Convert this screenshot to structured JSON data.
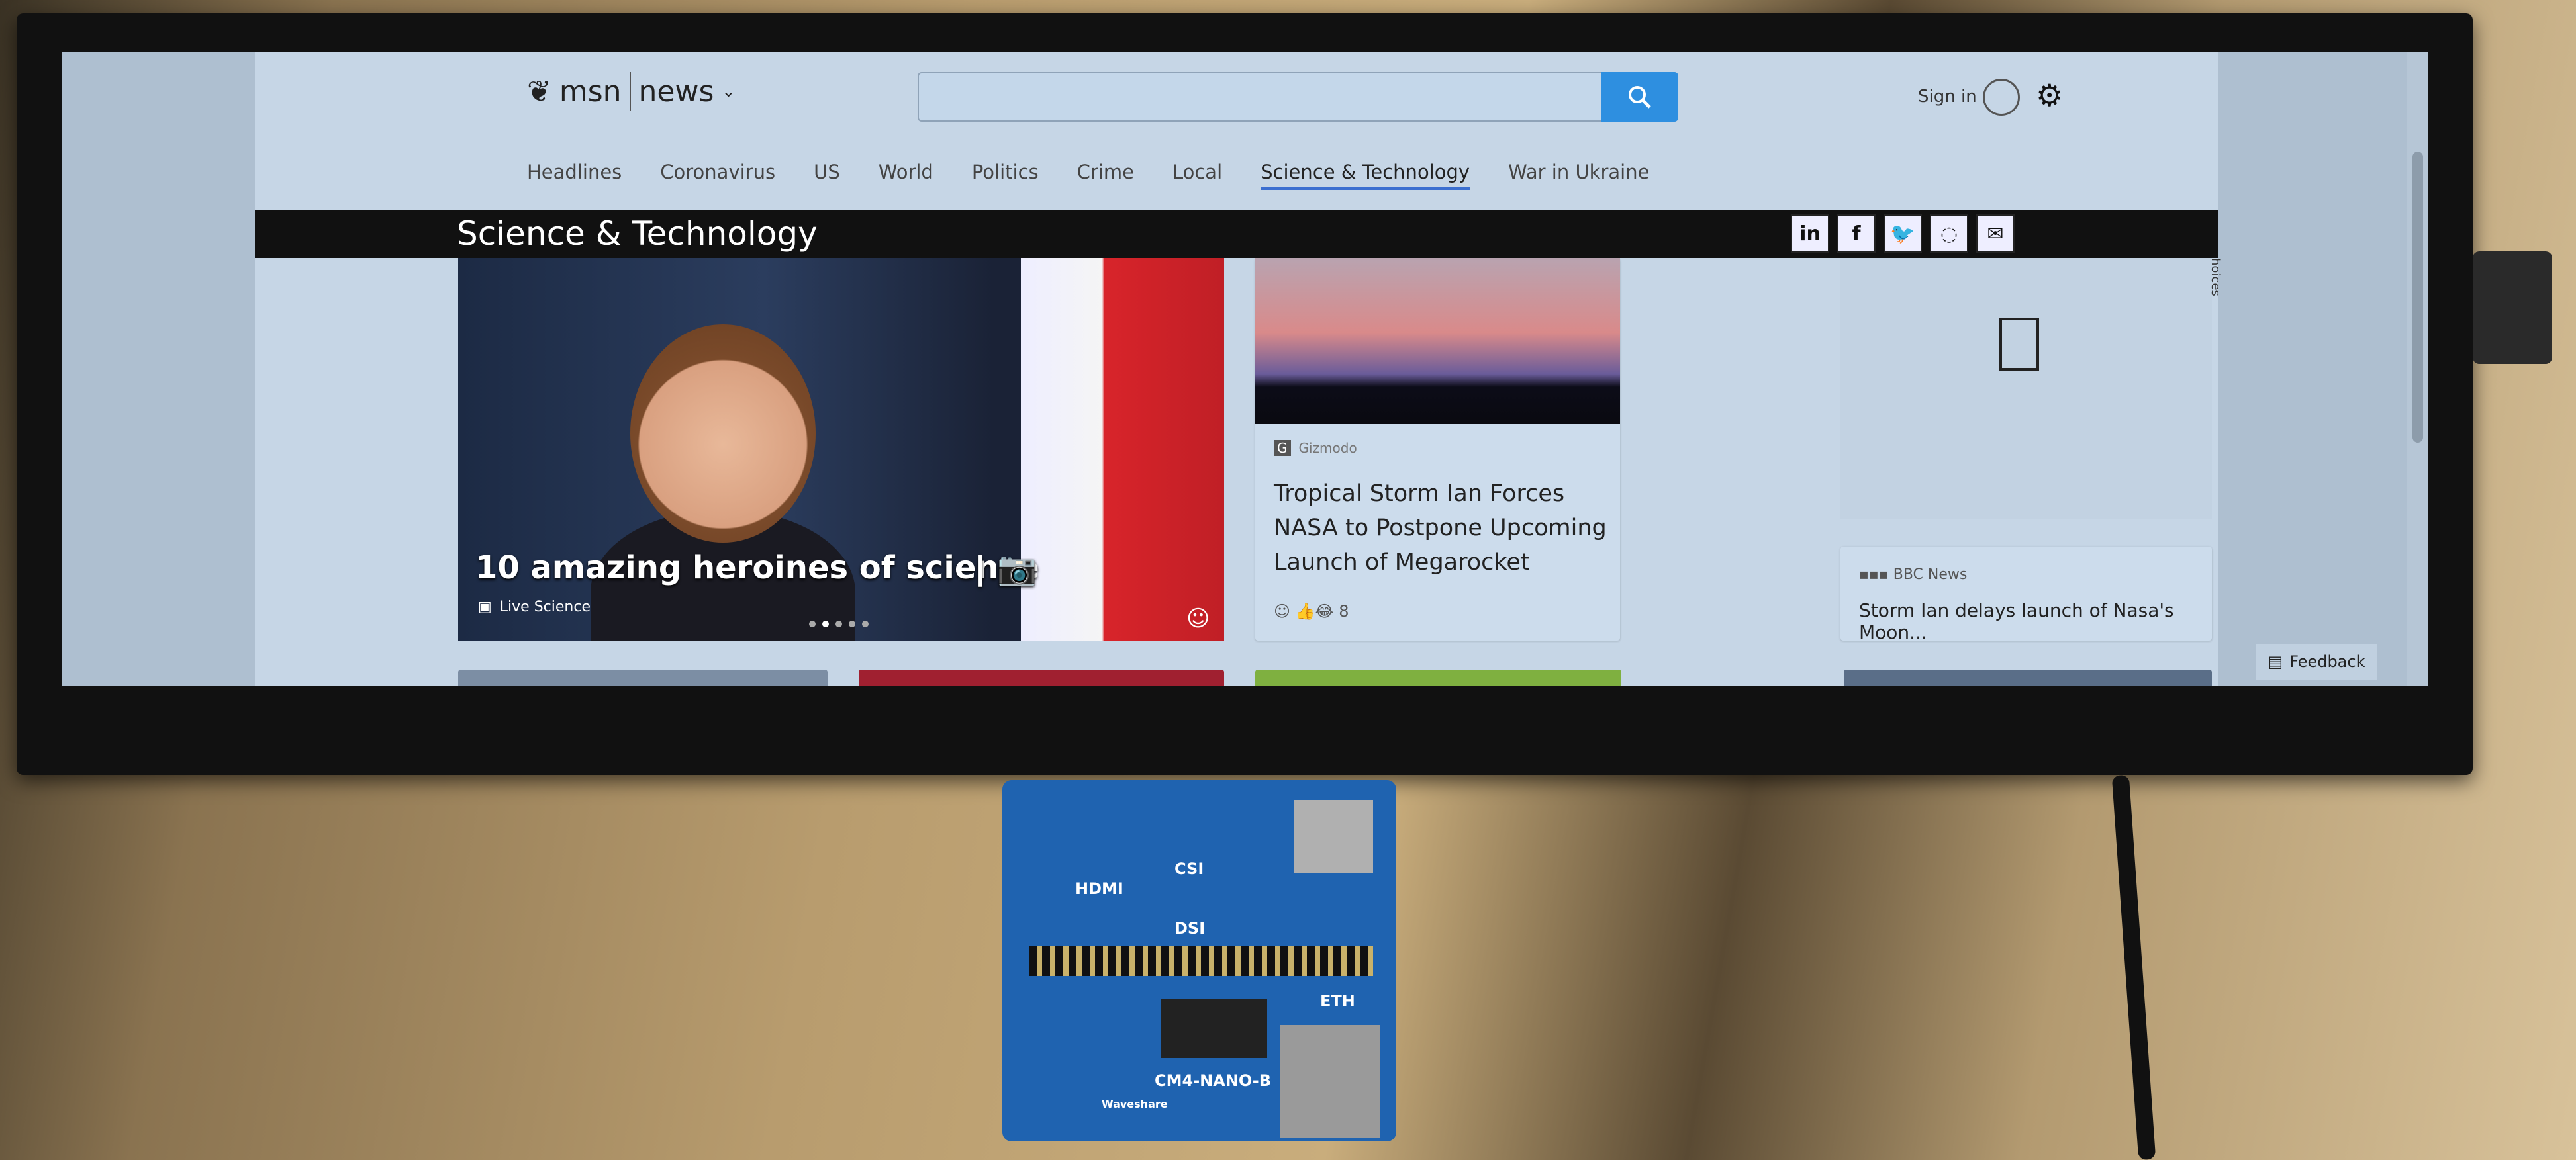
{
  "header": {
    "logo_brand": "msn",
    "logo_section": "news",
    "search_placeholder": "",
    "sign_in": "Sign in"
  },
  "nav": {
    "items": [
      "Headlines",
      "Coronavirus",
      "US",
      "World",
      "Politics",
      "Crime",
      "Local",
      "Science & Technology",
      "War in Ukraine"
    ],
    "active": "Science & Technology"
  },
  "section": {
    "title": "Science & Technology",
    "share_icons": [
      "linkedin-icon",
      "facebook-icon",
      "twitter-icon",
      "whatsapp-icon",
      "email-icon"
    ]
  },
  "hero": {
    "headline": "10 amazing heroines of science",
    "source": "Live Science"
  },
  "card_gizmodo": {
    "source": "Gizmodo",
    "headline": "Tropical Storm Ian Forces NASA to Postpone Upcoming Launch of Megarocket",
    "reactions": "8"
  },
  "card_bbc": {
    "source": "BBC News",
    "headline": "Storm Ian delays launch of Nasa's Moon..."
  },
  "ad_label": "hoices",
  "feedback": "Feedback",
  "board": {
    "labels": [
      "HDMI",
      "CSI",
      "DSI",
      "ETH",
      "CM4-NANO-B",
      "Waveshare"
    ]
  },
  "colors": {
    "accent": "#2e8fe0",
    "section_bar": "#111111",
    "nav_underline": "#3b6fd0"
  }
}
